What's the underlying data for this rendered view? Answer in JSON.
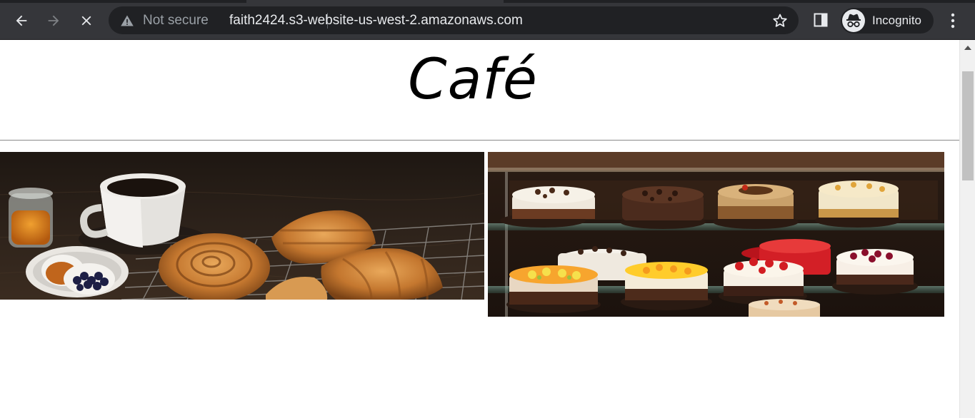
{
  "browser": {
    "security_label": "Not secure",
    "url": "faith2424.s3-website-us-west-2.amazonaws.com",
    "profile_label": "Incognito",
    "icons": {
      "back": "back-arrow-icon",
      "forward": "forward-arrow-icon",
      "stop": "close-icon",
      "security": "warning-triangle-icon",
      "bookmark": "star-icon",
      "side_panel": "side-panel-icon",
      "profile": "incognito-icon",
      "menu": "kebab-menu-icon"
    },
    "colors": {
      "toolbar": "#35363a",
      "omnibox": "#202124",
      "text": "#e8eaed",
      "muted": "#9aa0a6"
    }
  },
  "page": {
    "title": "Café",
    "images": [
      {
        "subject": "coffee cup with croissants, pastries, jam and berries"
      },
      {
        "subject": "glass display case of cakes"
      }
    ]
  }
}
